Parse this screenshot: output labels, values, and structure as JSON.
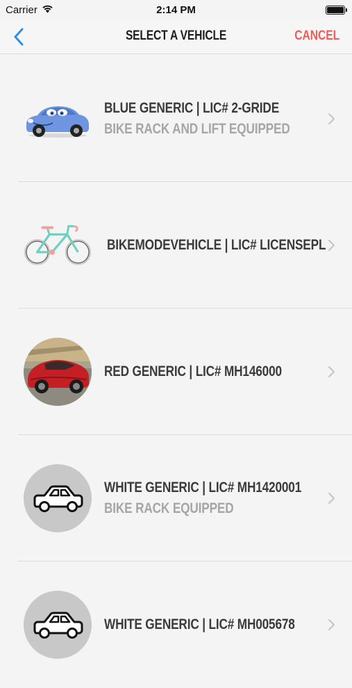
{
  "status_bar": {
    "carrier": "Carrier",
    "time": "2:14 PM"
  },
  "nav": {
    "title": "SELECT A VEHICLE",
    "cancel_label": "CANCEL",
    "accent_color": "#ef5c5c",
    "back_color": "#2f8fe0"
  },
  "vehicles": [
    {
      "title": "BLUE GENERIC   |  LIC# 2-GRIDE",
      "subtitle": "BIKE RACK AND LIFT EQUIPPED",
      "image": "blue-cartoon-car"
    },
    {
      "title": "BIKEMODEVEHICLE   |  LIC# LICENSEPL",
      "subtitle": "",
      "image": "bicycle"
    },
    {
      "title": "RED GENERIC   |  LIC# MH146000",
      "subtitle": "",
      "image": "red-sports-car-photo"
    },
    {
      "title": "WHITE GENERIC   |  LIC# MH1420001",
      "subtitle": "BIKE RACK EQUIPPED",
      "image": "car-outline-icon"
    },
    {
      "title": "WHITE GENERIC   |  LIC# MH005678",
      "subtitle": "",
      "image": "car-outline-icon"
    }
  ]
}
